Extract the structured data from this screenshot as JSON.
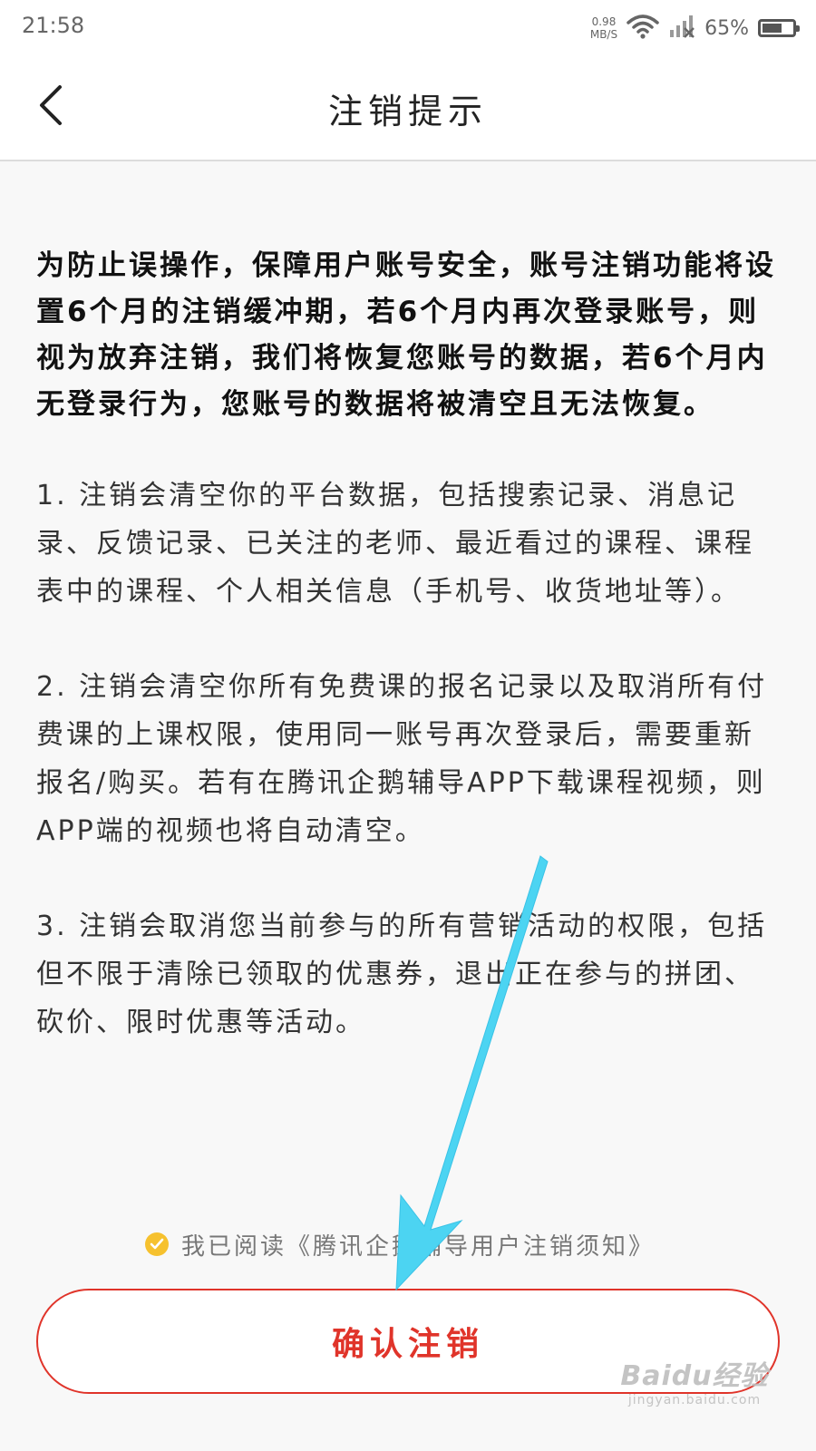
{
  "status_bar": {
    "time": "21:58",
    "net_speed_value": "0.98",
    "net_speed_unit": "MB/S",
    "battery_percent": "65%",
    "battery_level": 0.65,
    "icons": [
      "wifi-icon",
      "signal-icon",
      "battery-icon"
    ]
  },
  "nav": {
    "title": "注销提示",
    "back_icon": "chevron-left-icon"
  },
  "content": {
    "intro": "为防止误操作，保障用户账号安全，账号注销功能将设置6个月的注销缓冲期，若6个月内再次登录账号，则视为放弃注销，我们将恢复您账号的数据，若6个月内无登录行为，您账号的数据将被清空且无法恢复。",
    "items": [
      "1. 注销会清空你的平台数据，包括搜索记录、消息记录、反馈记录、已关注的老师、最近看过的课程、课程表中的课程、个人相关信息（手机号、收货地址等）。",
      "2. 注销会清空你所有免费课的报名记录以及取消所有付费课的上课权限，使用同一账号再次登录后，需要重新报名/购买。若有在腾讯企鹅辅导APP下载课程视频，则APP端的视频也将自动清空。",
      "3. 注销会取消您当前参与的所有营销活动的权限，包括但不限于清除已领取的优惠券，退出正在参与的拼团、砍价、限时优惠等活动。"
    ]
  },
  "agreement": {
    "text": "我已阅读《腾讯企鹅辅导用户注销须知》",
    "checked": true
  },
  "confirm_button": {
    "label": "确认注销"
  },
  "watermark": {
    "logo": "Baidu经验",
    "url": "jingyan.baidu.com"
  },
  "colors": {
    "accent_red": "#e0342a",
    "check_yellow": "#f6c12e",
    "annotation_arrow": "#4cd4f2"
  }
}
